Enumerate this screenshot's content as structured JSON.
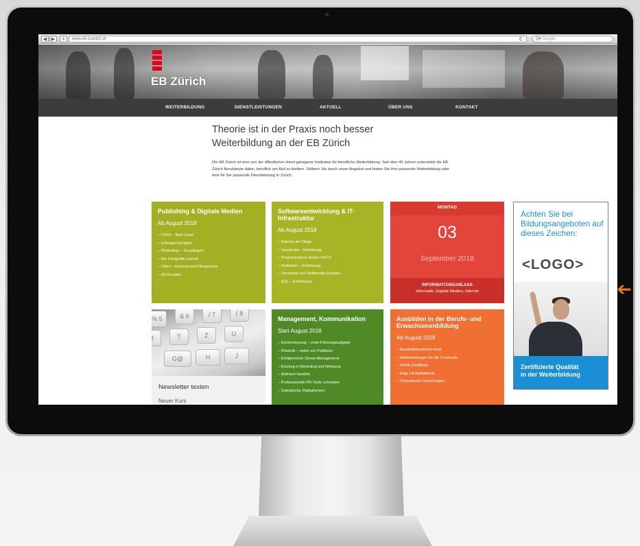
{
  "browser": {
    "url": "www.eb-zuerich.ch",
    "search_placeholder": "Google",
    "back_glyph": "◀",
    "forward_glyph": "▶",
    "add_glyph": "+",
    "reload_glyph": "C",
    "search_glyph": "Q▾"
  },
  "site": {
    "logo_text": "EB Zürich",
    "brand_color": "#e2001a"
  },
  "nav": {
    "items": [
      {
        "label": "WEITERBILDUNG"
      },
      {
        "label": "DIENSTLEISTUNGEN"
      },
      {
        "label": "AKTUELL"
      },
      {
        "label": "ÜBER UNS"
      },
      {
        "label": "KONTAKT"
      }
    ]
  },
  "intro": {
    "title_line1": "Theorie ist in der Praxis noch besser",
    "title_line2": "Weiterbildung an der EB Zürich",
    "text": "Die EB Zürich ist eine von der öffentlichen Hand getragene Institution für berufliche Weiterbildung. Seit über 45 Jahren unterstützt die EB Zürich Berufsleute dabei, beruflich am Ball zu bleiben. Stöbern Sie durch unser Angebot und finden Sie Ihre passende Weiterbildung oder eine für Sie passende Dienstleistung in Zürich."
  },
  "tiles": {
    "publishing": {
      "title": "Publishing & Digitale Medien",
      "subtitle": "Ab August 2018",
      "items": [
        "– CSS3 – Next Level",
        "– InDesign komplett",
        "– Photoshop – Grundlagen",
        "– Die Fotografie und ich",
        "– Video – Kamera und Filmsprache",
        "– 3D-Drucken"
      ]
    },
    "software": {
      "title": "Softwareentwicklung & IT-Infrastruktur",
      "subtitle": "Ab August 2018",
      "items": [
        "– Internet der Dinge",
        "– JavaScript – Einführung",
        "– Programmieren lernen mit C#",
        "– FileMaker – Einführung",
        "– Vernetzen von Multimedia-Geräten",
        "– SQL – Einführung"
      ]
    },
    "event": {
      "day": "MONTAG",
      "date": "03",
      "month": "September 2018",
      "type": "INFORMATIONSANLASS",
      "topics": "Informatik, Digitale Medien, Internet"
    },
    "management": {
      "title": "Management, Kommunikation",
      "subtitle": "Start August 2018",
      "items": [
        "– Karrieresprung – erste Führungsaufgabe",
        "– Rhetorik – reden vor Publikum",
        "– Erfolgreiches Stress-Management",
        "– Einstieg in Marketing und Werbung",
        "– Motiviert handeln",
        "– Professionelle PR-Texte schreiben",
        "– Sokratische Dialogformen"
      ]
    },
    "ausbilden": {
      "title": "Ausbilden in der Berufs- und Erwachsenenbildung",
      "subtitle": "Ab August 2018",
      "items": [
        "– Berufsbildner/innen-Kurs",
        "– Weiterbildungen für die 3 Lernorte",
        "– SVEB-Zertifikate",
        "– Eidg. FA Ausbilder/in",
        "– Thematische Vertiefungen"
      ]
    },
    "newsletter": {
      "title": "Newsletter texten",
      "subtitle": "Neuer Kurs",
      "keys": [
        "%\n5",
        "&\n6",
        "/\n7",
        "(\n8",
        "R",
        "T",
        "Z",
        "U",
        "G@",
        "H",
        "J"
      ]
    }
  },
  "ad": {
    "text": "Achten Sie bei Bildungsangeboten auf dieses Zeichen:",
    "logo": "<LOGO>",
    "line1": "Zertifizierte Qualität",
    "line2": "in der Weiterbildung"
  },
  "annotation_arrow": "➔"
}
